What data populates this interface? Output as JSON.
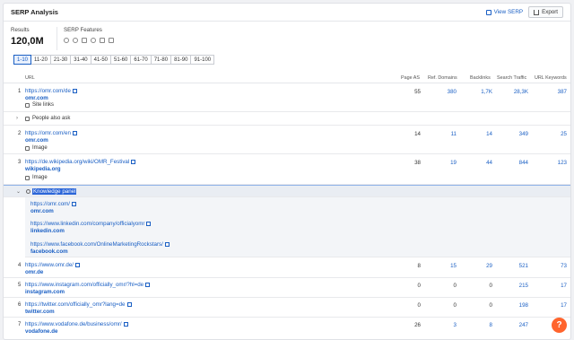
{
  "header": {
    "title": "SERP Analysis",
    "view_serp": "View SERP",
    "export": "Export"
  },
  "stats": {
    "results_label": "Results",
    "results_value": "120,0M",
    "features_label": "SERP Features"
  },
  "pager": [
    "1-10",
    "11-20",
    "21-30",
    "31-40",
    "41-50",
    "51-60",
    "61-70",
    "71-80",
    "81-90",
    "91-100"
  ],
  "columns": {
    "url": "URL",
    "page_as": "Page AS",
    "ref_domains": "Ref. Domains",
    "backlinks": "Backlinks",
    "search_traffic": "Search Traffic",
    "url_keywords": "URL Keywords"
  },
  "rows": [
    {
      "num": "1",
      "url": "https://omr.com/de",
      "domain": "omr.com",
      "feature": "Site links",
      "page_as": "55",
      "ref": "380",
      "bl": "1,7K",
      "traffic": "28,3K",
      "kw": "387"
    },
    {
      "label": "People also ask"
    },
    {
      "num": "2",
      "url": "https://omr.com/en",
      "domain": "omr.com",
      "feature": "Image",
      "page_as": "14",
      "ref": "11",
      "bl": "14",
      "traffic": "349",
      "kw": "25"
    },
    {
      "num": "3",
      "url": "https://de.wikipedia.org/wiki/OMR_Festival",
      "domain": "wikipedia.org",
      "feature": "Image",
      "page_as": "38",
      "ref": "19",
      "bl": "44",
      "traffic": "844",
      "kw": "123"
    },
    {
      "label": "Knowledge panel",
      "links": [
        {
          "url": "https://omr.com/",
          "domain": "omr.com"
        },
        {
          "url": "https://www.linkedin.com/company/officialyomr",
          "domain": "linkedin.com"
        },
        {
          "url": "https://www.facebook.com/OnlineMarketingRockstars/",
          "domain": "facebook.com"
        }
      ]
    },
    {
      "num": "4",
      "url": "https://www.omr.de/",
      "domain": "omr.de",
      "page_as": "8",
      "ref": "15",
      "bl": "29",
      "traffic": "521",
      "kw": "73"
    },
    {
      "num": "5",
      "url": "https://www.instagram.com/officially_omr/?hl=de",
      "domain": "instagram.com",
      "page_as": "0",
      "ref": "0",
      "bl": "0",
      "traffic": "215",
      "kw": "17"
    },
    {
      "num": "6",
      "url": "https://twitter.com/officially_omr?lang=de",
      "domain": "twitter.com",
      "page_as": "0",
      "ref": "0",
      "bl": "0",
      "traffic": "198",
      "kw": "17"
    },
    {
      "num": "7",
      "url": "https://www.vodafone.de/business/omr/",
      "domain": "vodafone.de",
      "page_as": "26",
      "ref": "3",
      "bl": "8",
      "traffic": "247",
      "kw": ""
    }
  ],
  "help_label": "?"
}
